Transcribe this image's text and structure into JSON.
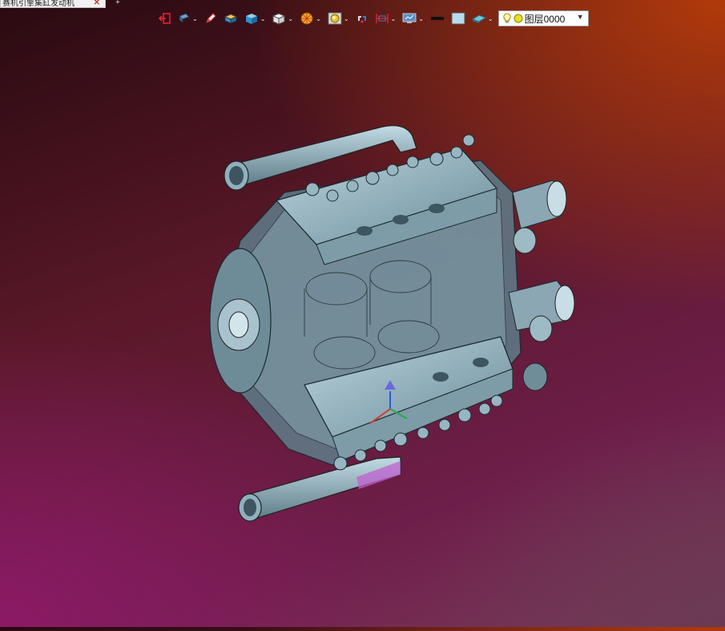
{
  "document_tab": {
    "title": "赛机引擎集缸发动机",
    "close_glyph": "✕"
  },
  "new_tab_glyph": "+",
  "toolbar": {
    "items": [
      {
        "name": "exit-sketch-icon",
        "dropdown": false
      },
      {
        "name": "view-orient-icon",
        "dropdown": true
      },
      {
        "name": "pencil-icon",
        "dropdown": false
      },
      {
        "name": "layer-box-icon",
        "dropdown": false
      },
      {
        "name": "shaded-cube-icon",
        "dropdown": true
      },
      {
        "name": "wire-cube-icon",
        "dropdown": true
      },
      {
        "name": "render-ball-icon",
        "dropdown": true
      },
      {
        "name": "display-filter-icon",
        "dropdown": true
      },
      {
        "name": "snap-icon",
        "dropdown": false
      },
      {
        "name": "section-icon",
        "dropdown": true
      },
      {
        "name": "monitor-icon",
        "dropdown": true
      },
      {
        "name": "line-style-icon",
        "dropdown": false
      },
      {
        "name": "color-swatch-icon",
        "dropdown": false
      },
      {
        "name": "surface-icon",
        "dropdown": true
      }
    ],
    "layer_dropdown": {
      "value": "图层0000",
      "arrow": "▼"
    }
  },
  "colors": {
    "accent": "#7fa6b8",
    "part_dark": "#3f5560",
    "selection": "#c060d0"
  }
}
